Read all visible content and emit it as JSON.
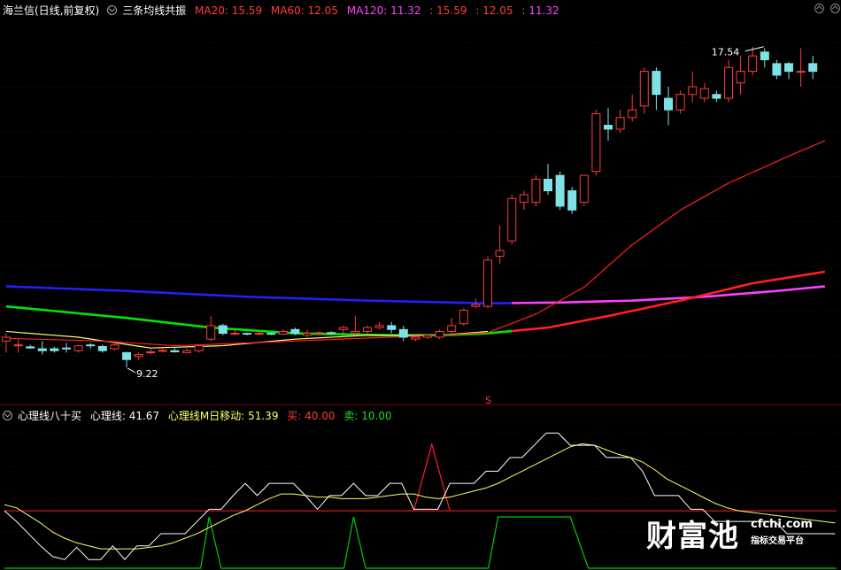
{
  "main_panel": {
    "indicator_name": "海兰信(日线,前复权)",
    "formula_name": "三条均线共振",
    "ma20_label": "MA20: 15.59",
    "ma60_label": "MA60: 12.05",
    "ma120_label": "MA120: 11.32",
    "val1": ": 15.59",
    "val2": ": 12.05",
    "val3": ": 11.32",
    "high_annotation": "17.54",
    "low_annotation": "9.22",
    "signal_marker": "S"
  },
  "sub_panel": {
    "name": "心理线八十买",
    "psy_label": "心理线: 41.67",
    "psy_ma_label": "心理线M日移动: 51.39",
    "buy_label": "买: 40.00",
    "sell_label": "卖: 10.00"
  },
  "watermark": {
    "logo": "财富池",
    "domain": "cfchi.com",
    "tagline": "指标交易平台"
  },
  "colors": {
    "up": "#ff3b3b",
    "down": "#7fe3e6",
    "ma20": "#ff2020",
    "ma60_old": "#00e600",
    "ma60_new": "#ff40ff",
    "ma120": "#2020ff",
    "yellow": "#ffff66",
    "psy": "#ffffff",
    "buy_line": "#ff2020",
    "sell_line": "#00cc00"
  },
  "chart_data": [
    {
      "type": "candlestick",
      "title": "海兰信(日线,前复权)",
      "ylim": [
        8.3,
        18.2
      ],
      "annotations": [
        {
          "text": "17.54",
          "value": 17.54,
          "kind": "high"
        },
        {
          "text": "9.22",
          "value": 9.22,
          "kind": "low"
        }
      ],
      "candles": [
        {
          "o": 9.9,
          "h": 10.1,
          "l": 9.6,
          "c": 10.0
        },
        {
          "o": 9.8,
          "h": 9.95,
          "l": 9.6,
          "c": 9.8
        },
        {
          "o": 9.75,
          "h": 9.8,
          "l": 9.7,
          "c": 9.72
        },
        {
          "o": 9.7,
          "h": 9.9,
          "l": 9.55,
          "c": 9.65
        },
        {
          "o": 9.7,
          "h": 9.75,
          "l": 9.6,
          "c": 9.65
        },
        {
          "o": 9.72,
          "h": 9.85,
          "l": 9.6,
          "c": 9.7
        },
        {
          "o": 9.65,
          "h": 9.8,
          "l": 9.6,
          "c": 9.78
        },
        {
          "o": 9.8,
          "h": 9.85,
          "l": 9.7,
          "c": 9.78
        },
        {
          "o": 9.76,
          "h": 9.8,
          "l": 9.6,
          "c": 9.65
        },
        {
          "o": 9.7,
          "h": 9.9,
          "l": 9.65,
          "c": 9.8
        },
        {
          "o": 9.6,
          "h": 9.62,
          "l": 9.22,
          "c": 9.42
        },
        {
          "o": 9.5,
          "h": 9.6,
          "l": 9.4,
          "c": 9.55
        },
        {
          "o": 9.6,
          "h": 9.7,
          "l": 9.55,
          "c": 9.62
        },
        {
          "o": 9.65,
          "h": 9.7,
          "l": 9.6,
          "c": 9.66
        },
        {
          "o": 9.65,
          "h": 9.75,
          "l": 9.6,
          "c": 9.62
        },
        {
          "o": 9.6,
          "h": 9.7,
          "l": 9.58,
          "c": 9.65
        },
        {
          "o": 9.65,
          "h": 9.8,
          "l": 9.6,
          "c": 9.78
        },
        {
          "o": 9.95,
          "h": 10.55,
          "l": 9.9,
          "c": 10.3
        },
        {
          "o": 10.3,
          "h": 10.35,
          "l": 10.05,
          "c": 10.1
        },
        {
          "o": 10.1,
          "h": 10.2,
          "l": 10.05,
          "c": 10.1
        },
        {
          "o": 10.1,
          "h": 10.12,
          "l": 10.05,
          "c": 10.08
        },
        {
          "o": 10.1,
          "h": 10.15,
          "l": 10.05,
          "c": 10.1
        },
        {
          "o": 10.1,
          "h": 10.12,
          "l": 10.05,
          "c": 10.08
        },
        {
          "o": 10.08,
          "h": 10.2,
          "l": 10.05,
          "c": 10.15
        },
        {
          "o": 10.2,
          "h": 10.25,
          "l": 10.05,
          "c": 10.1
        },
        {
          "o": 10.05,
          "h": 10.2,
          "l": 10.0,
          "c": 10.1
        },
        {
          "o": 10.1,
          "h": 10.15,
          "l": 10.05,
          "c": 10.12
        },
        {
          "o": 10.12,
          "h": 10.15,
          "l": 10.05,
          "c": 10.1
        },
        {
          "o": 10.2,
          "h": 10.3,
          "l": 10.1,
          "c": 10.25
        },
        {
          "o": 10.1,
          "h": 10.55,
          "l": 10.05,
          "c": 10.15
        },
        {
          "o": 10.15,
          "h": 10.3,
          "l": 10.1,
          "c": 10.25
        },
        {
          "o": 10.25,
          "h": 10.4,
          "l": 10.2,
          "c": 10.3
        },
        {
          "o": 10.3,
          "h": 10.4,
          "l": 10.1,
          "c": 10.2
        },
        {
          "o": 10.2,
          "h": 10.3,
          "l": 9.9,
          "c": 10.0
        },
        {
          "o": 9.95,
          "h": 10.05,
          "l": 9.9,
          "c": 10.0
        },
        {
          "o": 10.0,
          "h": 10.05,
          "l": 9.95,
          "c": 10.05
        },
        {
          "o": 10.0,
          "h": 10.2,
          "l": 9.95,
          "c": 10.15
        },
        {
          "o": 10.15,
          "h": 10.5,
          "l": 10.1,
          "c": 10.3
        },
        {
          "o": 10.35,
          "h": 10.75,
          "l": 10.3,
          "c": 10.7
        },
        {
          "o": 10.8,
          "h": 11.0,
          "l": 10.75,
          "c": 10.85
        },
        {
          "o": 10.8,
          "h": 12.1,
          "l": 10.75,
          "c": 12.0
        },
        {
          "o": 12.1,
          "h": 12.9,
          "l": 11.9,
          "c": 12.25
        },
        {
          "o": 12.5,
          "h": 13.7,
          "l": 12.4,
          "c": 13.6
        },
        {
          "o": 13.5,
          "h": 13.8,
          "l": 13.3,
          "c": 13.7
        },
        {
          "o": 13.5,
          "h": 14.2,
          "l": 13.4,
          "c": 14.1
        },
        {
          "o": 14.1,
          "h": 14.5,
          "l": 13.7,
          "c": 13.8
        },
        {
          "o": 14.2,
          "h": 14.3,
          "l": 13.3,
          "c": 13.4
        },
        {
          "o": 13.8,
          "h": 13.9,
          "l": 13.2,
          "c": 13.3
        },
        {
          "o": 13.5,
          "h": 14.2,
          "l": 13.4,
          "c": 14.2
        },
        {
          "o": 14.3,
          "h": 15.9,
          "l": 14.2,
          "c": 15.8
        },
        {
          "o": 15.5,
          "h": 15.95,
          "l": 15.1,
          "c": 15.4
        },
        {
          "o": 15.4,
          "h": 15.9,
          "l": 15.3,
          "c": 15.7
        },
        {
          "o": 15.7,
          "h": 16.3,
          "l": 15.6,
          "c": 15.9
        },
        {
          "o": 16.0,
          "h": 17.0,
          "l": 15.8,
          "c": 16.9
        },
        {
          "o": 16.9,
          "h": 17.0,
          "l": 15.9,
          "c": 16.3
        },
        {
          "o": 16.2,
          "h": 16.5,
          "l": 15.5,
          "c": 15.9
        },
        {
          "o": 15.9,
          "h": 16.4,
          "l": 15.8,
          "c": 16.3
        },
        {
          "o": 16.3,
          "h": 16.9,
          "l": 16.1,
          "c": 16.5
        },
        {
          "o": 16.2,
          "h": 16.6,
          "l": 16.1,
          "c": 16.45
        },
        {
          "o": 16.3,
          "h": 16.4,
          "l": 16.1,
          "c": 16.2
        },
        {
          "o": 16.2,
          "h": 17.2,
          "l": 16.1,
          "c": 17.0
        },
        {
          "o": 16.6,
          "h": 17.3,
          "l": 16.3,
          "c": 16.9
        },
        {
          "o": 16.9,
          "h": 17.54,
          "l": 16.8,
          "c": 17.3
        },
        {
          "o": 17.4,
          "h": 17.5,
          "l": 17.0,
          "c": 17.2
        },
        {
          "o": 17.1,
          "h": 17.2,
          "l": 16.7,
          "c": 16.8
        },
        {
          "o": 17.1,
          "h": 17.15,
          "l": 16.7,
          "c": 16.9
        },
        {
          "o": 16.9,
          "h": 17.5,
          "l": 16.5,
          "c": 16.9
        },
        {
          "o": 17.1,
          "h": 17.3,
          "l": 16.7,
          "c": 16.9
        }
      ],
      "series": [
        {
          "name": "MA20",
          "values_at": [
            [
              0,
              9.97
            ],
            [
              8,
              9.9
            ],
            [
              14,
              9.78
            ],
            [
              20,
              9.85
            ],
            [
              30,
              9.98
            ],
            [
              36,
              10.05
            ],
            [
              40,
              10.12
            ],
            [
              44,
              10.6
            ],
            [
              48,
              11.3
            ],
            [
              52,
              12.4
            ],
            [
              56,
              13.3
            ],
            [
              60,
              14.0
            ],
            [
              65,
              14.7
            ],
            [
              68,
              15.1
            ]
          ]
        },
        {
          "name": "MA60",
          "values_at": [
            [
              0,
              10.8
            ],
            [
              10,
              10.5
            ],
            [
              17,
              10.25
            ],
            [
              24,
              10.1
            ],
            [
              32,
              10.05
            ],
            [
              36,
              10.05
            ],
            [
              40,
              10.1
            ],
            [
              45,
              10.25
            ],
            [
              50,
              10.55
            ],
            [
              56,
              10.95
            ],
            [
              62,
              11.4
            ],
            [
              68,
              11.7
            ]
          ]
        },
        {
          "name": "MA120",
          "values_at": [
            [
              0,
              11.32
            ],
            [
              10,
              11.2
            ],
            [
              20,
              11.05
            ],
            [
              30,
              10.95
            ],
            [
              40,
              10.88
            ],
            [
              46,
              10.9
            ],
            [
              52,
              10.95
            ],
            [
              58,
              11.05
            ],
            [
              64,
              11.2
            ],
            [
              68,
              11.32
            ]
          ]
        },
        {
          "name": "yellow",
          "values_at": [
            [
              0,
              10.15
            ],
            [
              6,
              10.0
            ],
            [
              12,
              9.72
            ],
            [
              18,
              9.78
            ],
            [
              24,
              9.95
            ],
            [
              30,
              10.05
            ],
            [
              36,
              10.05
            ],
            [
              40,
              10.15
            ]
          ]
        }
      ]
    },
    {
      "type": "line",
      "title": "心理线八十买",
      "ylim": [
        0,
        100
      ],
      "series": [
        {
          "name": "心理线",
          "values": [
            40,
            33,
            25,
            17,
            10,
            8,
            16,
            8,
            8,
            17,
            8,
            17,
            17,
            25,
            25,
            25,
            33,
            41,
            41,
            50,
            58,
            50,
            58,
            58,
            58,
            50,
            41,
            50,
            50,
            58,
            50,
            50,
            58,
            58,
            41,
            41,
            41,
            58,
            58,
            58,
            66,
            66,
            75,
            75,
            83,
            91,
            91,
            83,
            83,
            83,
            75,
            75,
            75,
            66,
            50,
            50,
            50,
            41,
            41,
            33,
            33,
            33,
            33,
            33,
            33,
            25,
            25,
            25,
            25,
            25
          ]
        },
        {
          "name": "心理线M日移动",
          "values": [
            44,
            42,
            37,
            32,
            26,
            22,
            19,
            17,
            15,
            15,
            15,
            15,
            16,
            17,
            19,
            22,
            25,
            29,
            33,
            37,
            40,
            44,
            48,
            51,
            51,
            50,
            49,
            49,
            48,
            48,
            48,
            49,
            50,
            51,
            51,
            49,
            48,
            49,
            51,
            53,
            55,
            58,
            62,
            66,
            70,
            74,
            78,
            82,
            84,
            83,
            80,
            77,
            75,
            72,
            67,
            61,
            57,
            53,
            49,
            45,
            42,
            40,
            39,
            38,
            37,
            36,
            35,
            34,
            33,
            32
          ]
        },
        {
          "name": "买",
          "values_const": 40.0
        },
        {
          "name": "卖",
          "values_const": 10.0
        }
      ]
    }
  ]
}
